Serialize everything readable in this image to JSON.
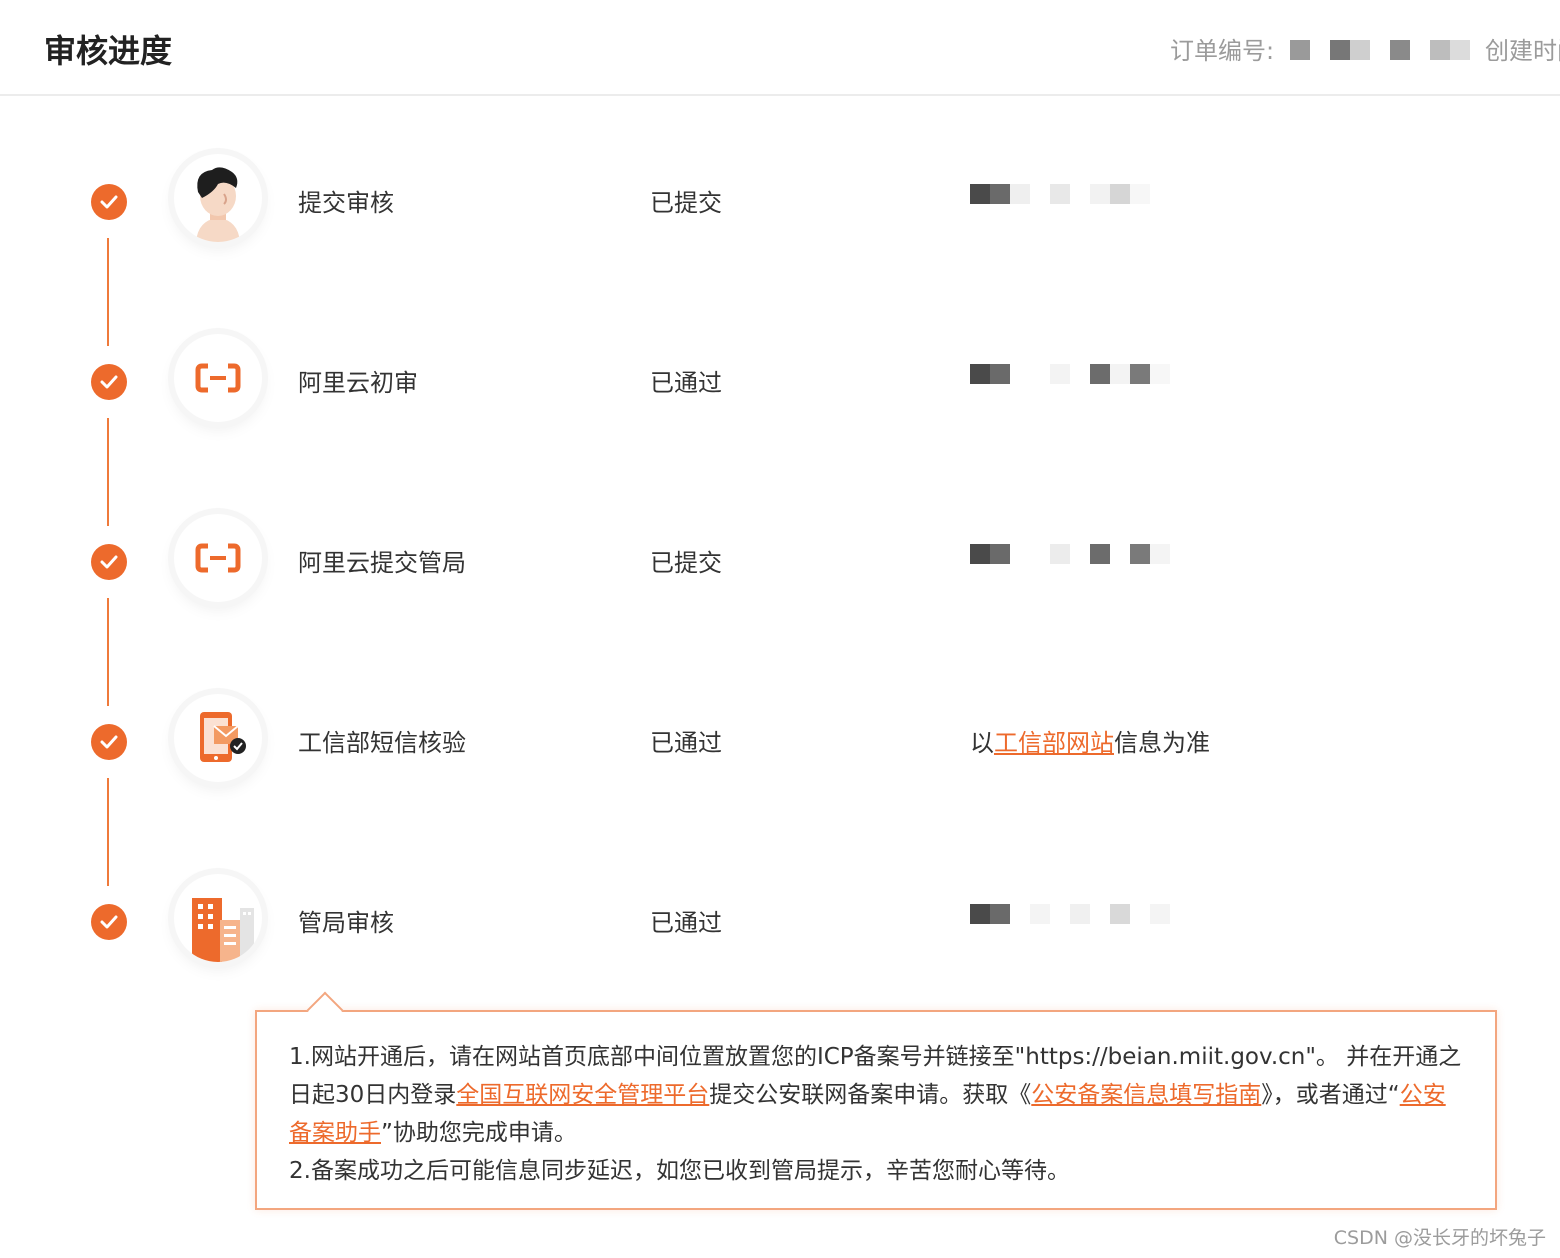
{
  "header": {
    "title": "审核进度",
    "order_label": "订单编号:",
    "created_label": "创建时间"
  },
  "steps": [
    {
      "label": "提交审核",
      "status": "已提交",
      "icon": "user-avatar-icon"
    },
    {
      "label": "阿里云初审",
      "status": "已通过",
      "icon": "aliyun-logo-icon"
    },
    {
      "label": "阿里云提交管局",
      "status": "已提交",
      "icon": "aliyun-logo-icon"
    },
    {
      "label": "工信部短信核验",
      "status": "已通过",
      "icon": "phone-sms-icon",
      "note_prefix": "以",
      "note_link": "工信部网站",
      "note_suffix": "信息为准"
    },
    {
      "label": "管局审核",
      "status": "已通过",
      "icon": "building-icon"
    }
  ],
  "notice": {
    "p1_a": "1.网站开通后，请在网站首页底部中间位置放置您的ICP备案号并链接至\"https://beian.miit.gov.cn\"。 并在开通之日起30日内登录",
    "p1_link1": "全国互联网安全管理平台",
    "p1_b": "提交公安联网备案申请。获取《",
    "p1_link2": "公安备案信息填写指南",
    "p1_c": "》，或者通过“",
    "p1_link3": "公安备案助手",
    "p1_d": "”协助您完成申请。",
    "p2": "2.备案成功之后可能信息同步延迟，如您已收到管局提示，辛苦您耐心等待。"
  },
  "watermark": "CSDN @没长牙的坏兔子",
  "colors": {
    "accent": "#ed6a2c",
    "line": "#ef7a3b",
    "notice_border": "#f3a67f"
  }
}
